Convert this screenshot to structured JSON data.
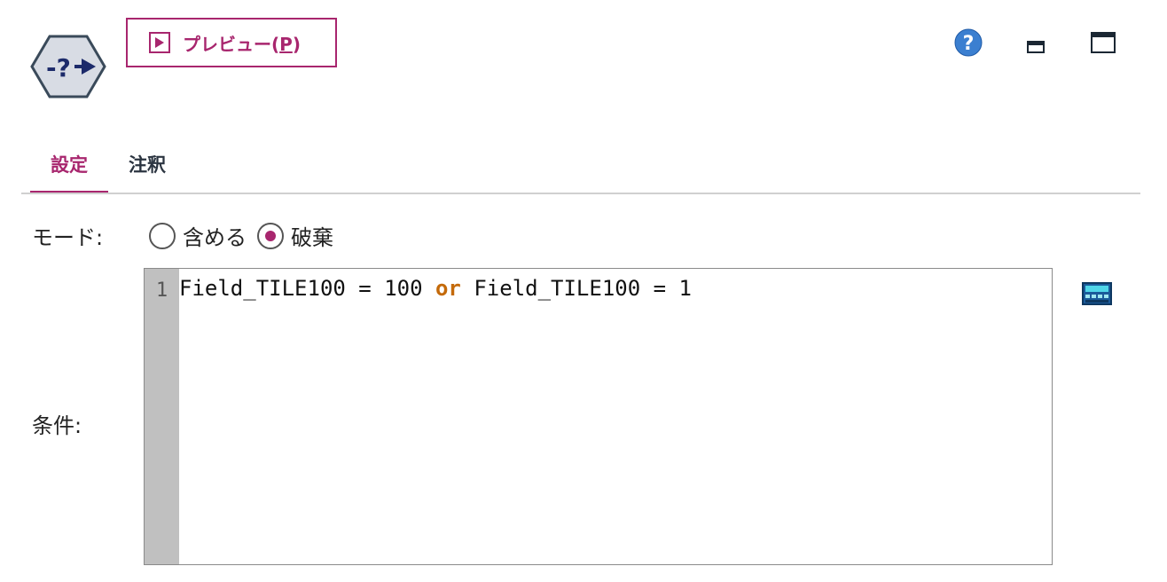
{
  "header": {
    "node_icon": "select-node-icon",
    "preview_button": {
      "label": "プレビュー(",
      "mnemonic": "P",
      "suffix": ")",
      "icon": "play-icon"
    },
    "controls": {
      "help": "help-icon",
      "minimize": "minimize-icon",
      "maximize": "maximize-icon"
    }
  },
  "tabs": [
    {
      "label": "設定",
      "active": true
    },
    {
      "label": "注釈",
      "active": false
    }
  ],
  "mode": {
    "label": "モード:",
    "options": [
      {
        "label": "含める",
        "selected": false
      },
      {
        "label": "破棄",
        "selected": true
      }
    ]
  },
  "condition": {
    "label": "条件:",
    "line_number": "1",
    "code_part1": "Field_TILE100 = 100 ",
    "keyword": "or",
    "code_part2": " Field_TILE100 = 1",
    "side_icon": "expression-builder-icon"
  },
  "colors": {
    "accent": "#a8266e",
    "keyword": "#c46a0a",
    "gutter": "#c0c0c0"
  }
}
